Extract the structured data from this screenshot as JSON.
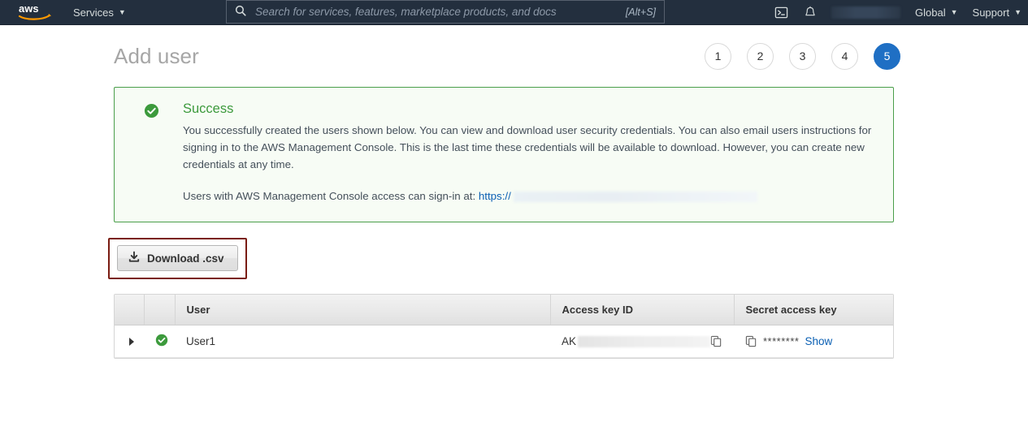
{
  "nav": {
    "logo": "aws-logo",
    "services_label": "Services",
    "search_placeholder": "Search for services, features, marketplace products, and docs",
    "search_value": "",
    "search_shortcut": "[Alt+S]",
    "cloudshell_icon": "cloudshell-terminal-icon",
    "notifications_icon": "bell-icon",
    "account_label": "",
    "region_label": "Global",
    "support_label": "Support",
    "background_color": "#232f3e"
  },
  "page": {
    "title": "Add user",
    "steps": [
      {
        "label": "1",
        "active": false
      },
      {
        "label": "2",
        "active": false
      },
      {
        "label": "3",
        "active": false
      },
      {
        "label": "4",
        "active": false
      },
      {
        "label": "5",
        "active": true
      }
    ],
    "active_step_color": "#1f6fc4"
  },
  "banner": {
    "status_icon": "success-check-circle-icon",
    "title": "Success",
    "title_color": "#3c9a3c",
    "border_color": "#4a9e4a",
    "background_color": "#f7fcf5",
    "paragraph": "You successfully created the users shown below. You can view and download user security credentials. You can also email users instructions for signing in to the AWS Management Console. This is the last time these credentials will be available to download. However, you can create new credentials at any time.",
    "signin_text": "Users with AWS Management Console access can sign-in at:",
    "signin_link": "https://",
    "signin_link_color": "#0a5fb3"
  },
  "download": {
    "label": "Download .csv",
    "icon": "download-icon",
    "highlight_color": "#7a1c12"
  },
  "table": {
    "columns": [
      "",
      "",
      "User",
      "Access key ID",
      "Secret access key"
    ],
    "rows": [
      {
        "expander_icon": "chevron-right-icon",
        "status_icon": "success-check-circle-icon",
        "user": "User1",
        "access_key_prefix": "AK",
        "access_key_copy_icon": "copy-icon",
        "secret_copy_icon": "copy-icon",
        "secret_mask": "********",
        "show_label": "Show"
      }
    ]
  }
}
